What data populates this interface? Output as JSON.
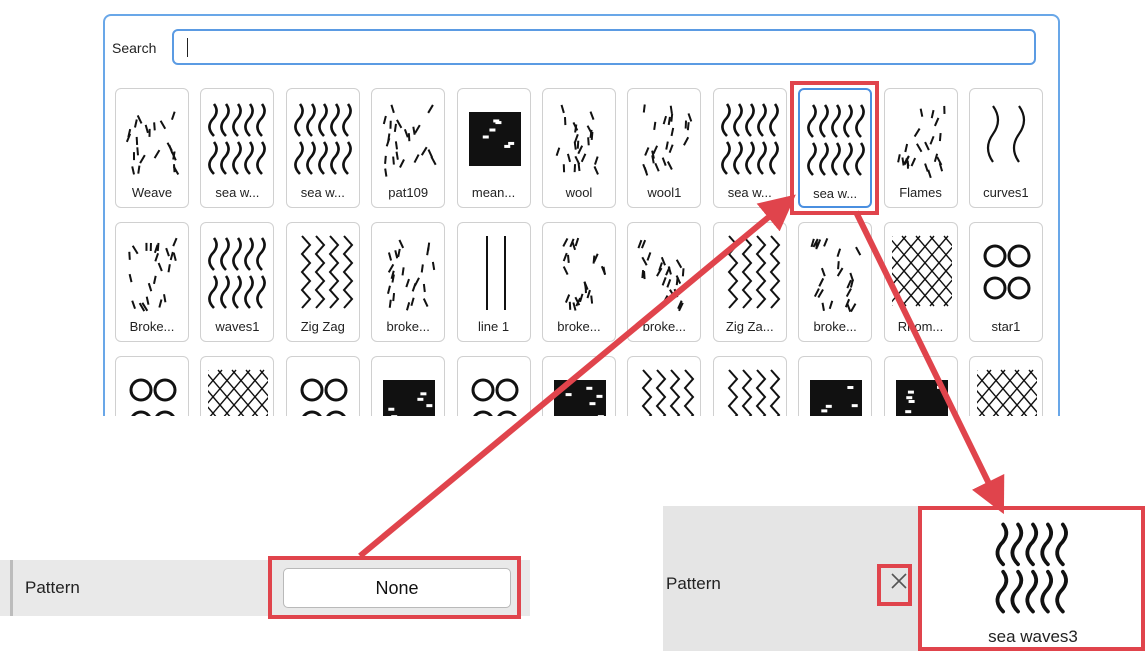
{
  "search": {
    "label": "Search",
    "value": "",
    "placeholder": ""
  },
  "patterns": [
    {
      "label": "Weave",
      "icon": "weave-pattern"
    },
    {
      "label": "sea w...",
      "icon": "sea-waves-pattern"
    },
    {
      "label": "sea w...",
      "icon": "sea-waves-dense-pattern"
    },
    {
      "label": "pat109",
      "icon": "dashes-pattern"
    },
    {
      "label": "mean...",
      "icon": "meander-pattern"
    },
    {
      "label": "wool",
      "icon": "wool-pattern"
    },
    {
      "label": "wool1",
      "icon": "wool1-pattern"
    },
    {
      "label": "sea w...",
      "icon": "sea-waves-pattern"
    },
    {
      "label": "sea w...",
      "icon": "sea-waves3-pattern",
      "selected": true
    },
    {
      "label": "Flames",
      "icon": "flames-pattern"
    },
    {
      "label": "curves1",
      "icon": "curves-pattern"
    },
    {
      "label": "Broke...",
      "icon": "broken-lines-pattern"
    },
    {
      "label": "waves1",
      "icon": "waves-pattern"
    },
    {
      "label": "Zig Zag",
      "icon": "zigzag-pattern"
    },
    {
      "label": "broke...",
      "icon": "broken-diagonal-pattern"
    },
    {
      "label": "line 1",
      "icon": "vertical-lines-pattern"
    },
    {
      "label": "broke...",
      "icon": "broken-diagonal-pattern"
    },
    {
      "label": "broke...",
      "icon": "broken-diagonal-pattern"
    },
    {
      "label": "Zig Za...",
      "icon": "zigzag-pattern"
    },
    {
      "label": "broke...",
      "icon": "broken-diagonal-pattern"
    },
    {
      "label": "Rhom...",
      "icon": "rhombus-pattern"
    },
    {
      "label": "star1",
      "icon": "star-pattern"
    },
    {
      "label": "",
      "icon": "star-pattern"
    },
    {
      "label": "",
      "icon": "cross-pattern"
    },
    {
      "label": "",
      "icon": "ornament-pattern"
    },
    {
      "label": "",
      "icon": "meander-pattern"
    },
    {
      "label": "",
      "icon": "rings-pattern"
    },
    {
      "label": "",
      "icon": "meander-pattern"
    },
    {
      "label": "",
      "icon": "herringbone-pattern"
    },
    {
      "label": "",
      "icon": "herringbone-pattern"
    },
    {
      "label": "",
      "icon": "weave-pattern"
    },
    {
      "label": "",
      "icon": "meander-pattern"
    },
    {
      "label": "",
      "icon": "cross-pattern"
    }
  ],
  "property_before": {
    "label": "Pattern",
    "value": "None"
  },
  "property_after": {
    "label": "Pattern",
    "clear_icon": "close-icon",
    "preview_label": "sea waves3"
  },
  "annotation_color": "#e0444c"
}
